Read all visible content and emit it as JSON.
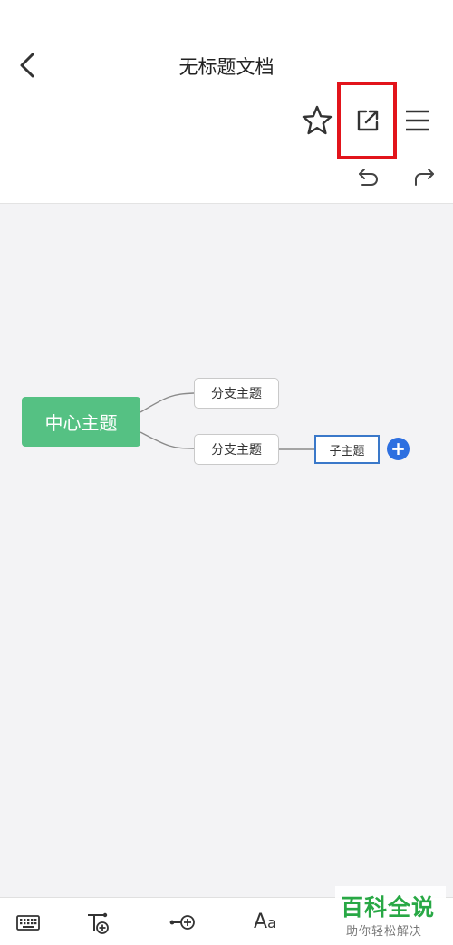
{
  "header": {
    "title": "无标题文档",
    "icons": {
      "back": "chevron-left-icon",
      "favorite": "star-icon",
      "share": "share-export-icon",
      "menu": "hamburger-menu-icon",
      "undo": "undo-icon",
      "redo": "redo-icon"
    }
  },
  "mindmap": {
    "central": "中心主题",
    "branches": [
      "分支主题",
      "分支主题"
    ],
    "subtopic": "子主题",
    "add_icon": "+"
  },
  "toolbar": {
    "keyboard_icon": "keyboard-icon",
    "add_child_icon": "add-child-topic-icon",
    "add_sibling_icon": "add-sibling-topic-icon",
    "font_label_large": "A",
    "font_label_small": "a"
  },
  "watermark": {
    "title": "百科全说",
    "subtitle": "助你轻松解决"
  },
  "colors": {
    "central_node": "#55c183",
    "highlight": "#e2141b",
    "selection": "#3a78c9",
    "add_button": "#2d6fe0",
    "canvas_bg": "#f3f3f5",
    "watermark_green": "#28a845"
  }
}
